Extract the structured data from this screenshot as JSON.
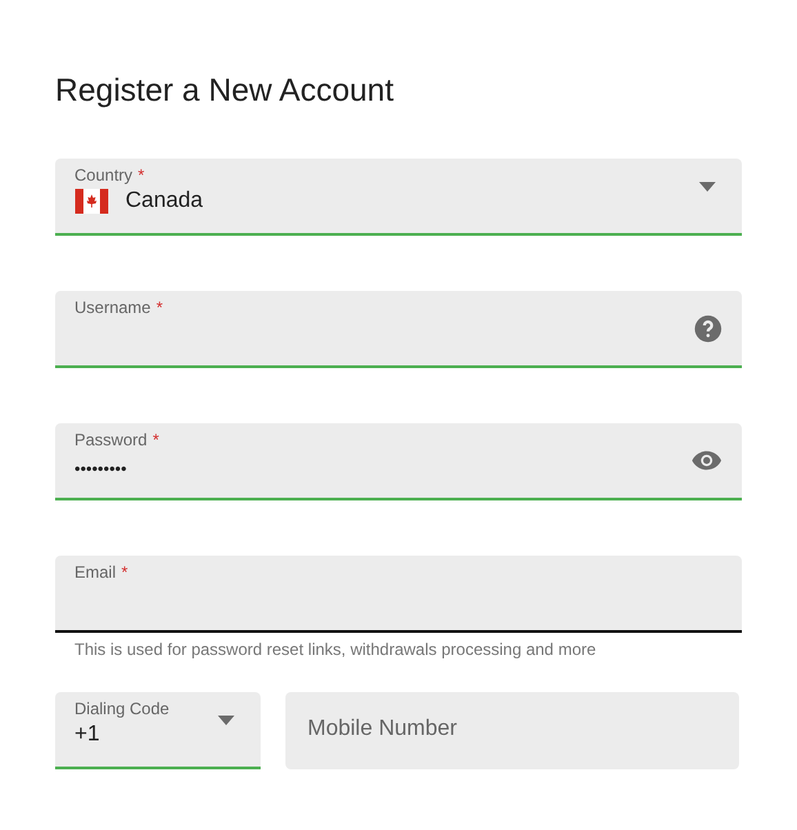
{
  "title": "Register a New Account",
  "fields": [
    {
      "kind": "country",
      "label": "Country",
      "required_mark": "*",
      "value": "Canada",
      "valid": true,
      "focused": false
    },
    {
      "kind": "username",
      "label": "Username",
      "required_mark": "*",
      "valid": true,
      "focused": false
    },
    {
      "kind": "password",
      "label": "Password",
      "required_mark": "*",
      "value": "•••••••••",
      "valid": true,
      "focused": false
    },
    {
      "kind": "text",
      "label": "Email",
      "required_mark": "*",
      "focused": true,
      "helper": "This is used for password reset links, withdrawals processing and more"
    }
  ],
  "phone": [
    {
      "kind": "select",
      "label": "Dialing Code",
      "value": "+1",
      "valid": true
    },
    {
      "kind": "text",
      "placeholder": "Mobile Number",
      "valid": false
    }
  ]
}
